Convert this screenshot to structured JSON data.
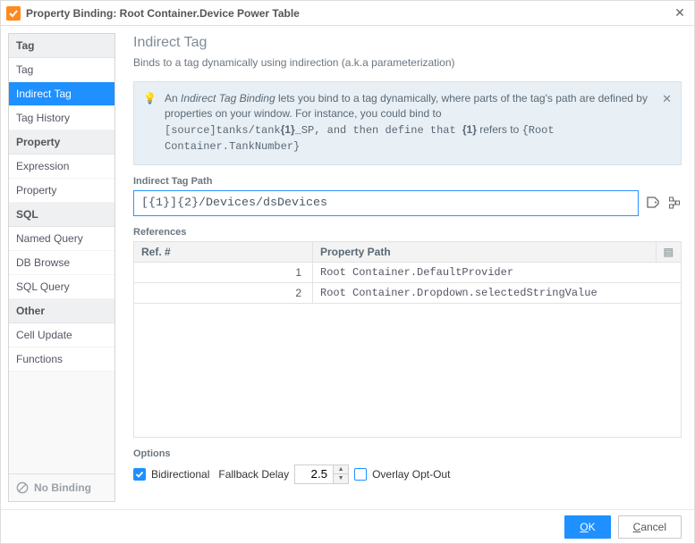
{
  "window": {
    "title": "Property Binding: Root Container.Device Power Table"
  },
  "sidebar": {
    "groups": [
      {
        "header": "Tag",
        "items": [
          "Tag",
          "Indirect Tag",
          "Tag History"
        ],
        "selectedIndex": 1
      },
      {
        "header": "Property",
        "items": [
          "Expression",
          "Property"
        ]
      },
      {
        "header": "SQL",
        "items": [
          "Named Query",
          "DB Browse",
          "SQL Query"
        ]
      },
      {
        "header": "Other",
        "items": [
          "Cell Update",
          "Functions"
        ]
      }
    ],
    "no_binding": "No Binding"
  },
  "page": {
    "title": "Indirect Tag",
    "subtitle": "Binds to a tag dynamically using indirection (a.k.a parameterization)"
  },
  "info": {
    "pre": "An ",
    "em": "Indirect Tag Binding",
    "post": " lets you bind to a tag dynamically, where parts of the tag's path are defined by properties on your window. For instance, you could bind to",
    "code1": "[source]tanks/tank",
    "b1": "{1}",
    "mid": "_SP, and then define that ",
    "b2": "{1}",
    "tail1": " refers to ",
    "tail2": "{Root Container.TankNumber}"
  },
  "labels": {
    "indirect_path": "Indirect Tag Path",
    "references": "References",
    "options": "Options",
    "bidirectional": "Bidirectional",
    "fallback": "Fallback Delay",
    "overlay": "Overlay Opt-Out"
  },
  "path": {
    "value": "[{1}]{2}/Devices/dsDevices"
  },
  "table": {
    "col_ref": "Ref. #",
    "col_prop": "Property Path",
    "rows": [
      {
        "n": "1",
        "p": "Root Container.DefaultProvider"
      },
      {
        "n": "2",
        "p": "Root Container.Dropdown.selectedStringValue"
      }
    ]
  },
  "options": {
    "fallback_value": "2.5"
  },
  "footer": {
    "ok": "OK",
    "cancel": "Cancel"
  }
}
